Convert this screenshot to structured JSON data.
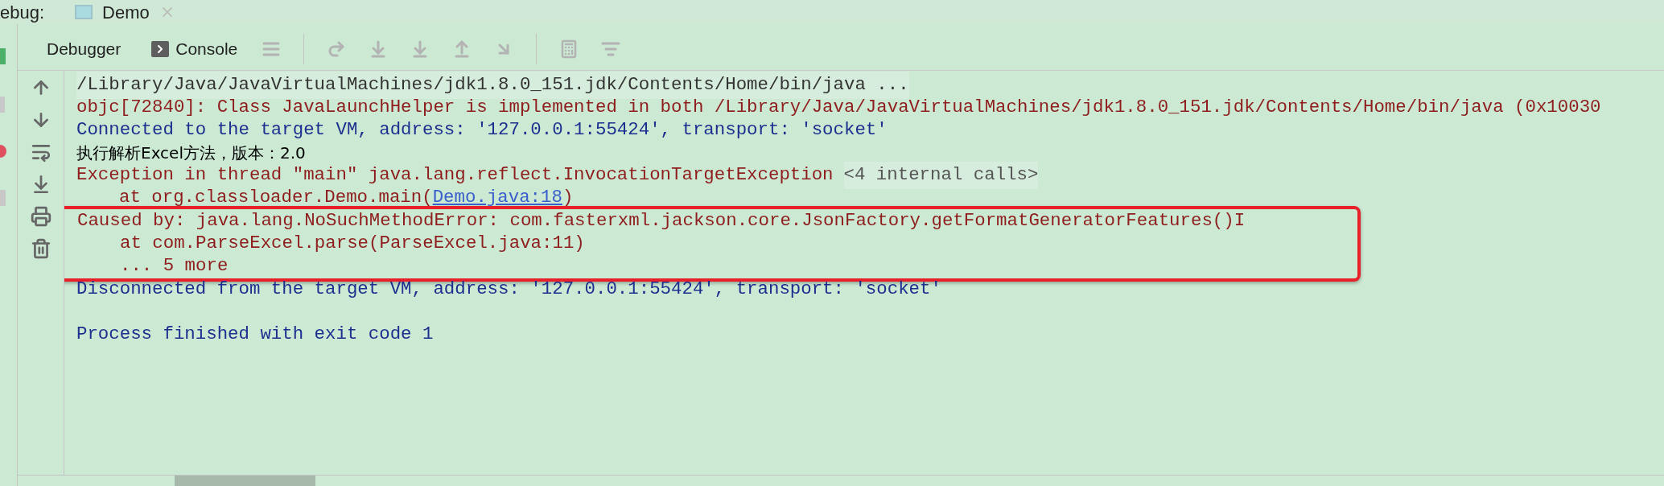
{
  "header": {
    "label": "ebug:",
    "tab": {
      "label": "Demo"
    }
  },
  "tabs": [
    {
      "kind": "debugger",
      "label": "Debugger"
    },
    {
      "kind": "console",
      "label": "Console"
    }
  ],
  "console": {
    "blocks": [
      {
        "highlighted": false,
        "lines": [
          {
            "indent": false,
            "spaced": false,
            "segments": [
              {
                "kind": "command",
                "text": "/Library/Java/JavaVirtualMachines/jdk1.8.0_151.jdk/Contents/Home/bin/java ..."
              }
            ]
          },
          {
            "indent": false,
            "spaced": false,
            "segments": [
              {
                "kind": "error",
                "text": "objc[72840]: Class JavaLaunchHelper is implemented in both /Library/Java/JavaVirtualMachines/jdk1.8.0_151.jdk/Contents/Home/bin/java (0x10030"
              }
            ]
          },
          {
            "indent": false,
            "spaced": false,
            "segments": [
              {
                "kind": "info",
                "text": "Connected to the target VM, address: '127.0.0.1:55424', transport: 'socket'"
              }
            ]
          },
          {
            "indent": false,
            "spaced": false,
            "segments": [
              {
                "kind": "output",
                "text": "执行解析Excel方法，版本：2.0"
              }
            ]
          },
          {
            "indent": false,
            "spaced": false,
            "segments": [
              {
                "kind": "error",
                "text": "Exception in thread \"main\" java.lang.reflect.InvocationTargetException"
              },
              {
                "kind": "folded",
                "text": "<4 internal calls>"
              }
            ]
          },
          {
            "indent": true,
            "spaced": false,
            "segments": [
              {
                "kind": "error",
                "text": "at org.classloader.Demo.main("
              },
              {
                "kind": "link",
                "text": "Demo.java:18"
              },
              {
                "kind": "error",
                "text": ")"
              }
            ]
          }
        ]
      },
      {
        "highlighted": true,
        "lines": [
          {
            "indent": false,
            "spaced": false,
            "segments": [
              {
                "kind": "error",
                "text": "Caused by: java.lang.NoSuchMethodError: com.fasterxml.jackson.core.JsonFactory.getFormatGeneratorFeatures()I"
              }
            ]
          },
          {
            "indent": true,
            "spaced": false,
            "segments": [
              {
                "kind": "error",
                "text": "at com.ParseExcel.parse(ParseExcel.java:11)"
              }
            ]
          },
          {
            "indent": true,
            "spaced": false,
            "segments": [
              {
                "kind": "error",
                "text": "... 5 more"
              }
            ]
          }
        ]
      },
      {
        "highlighted": false,
        "lines": [
          {
            "indent": false,
            "spaced": false,
            "segments": [
              {
                "kind": "info",
                "text": "Disconnected from the target VM, address: '127.0.0.1:55424', transport: 'socket'"
              }
            ]
          },
          {
            "indent": false,
            "spaced": true,
            "segments": [
              {
                "kind": "info",
                "text": "Process finished with exit code 1"
              }
            ]
          }
        ]
      }
    ]
  }
}
